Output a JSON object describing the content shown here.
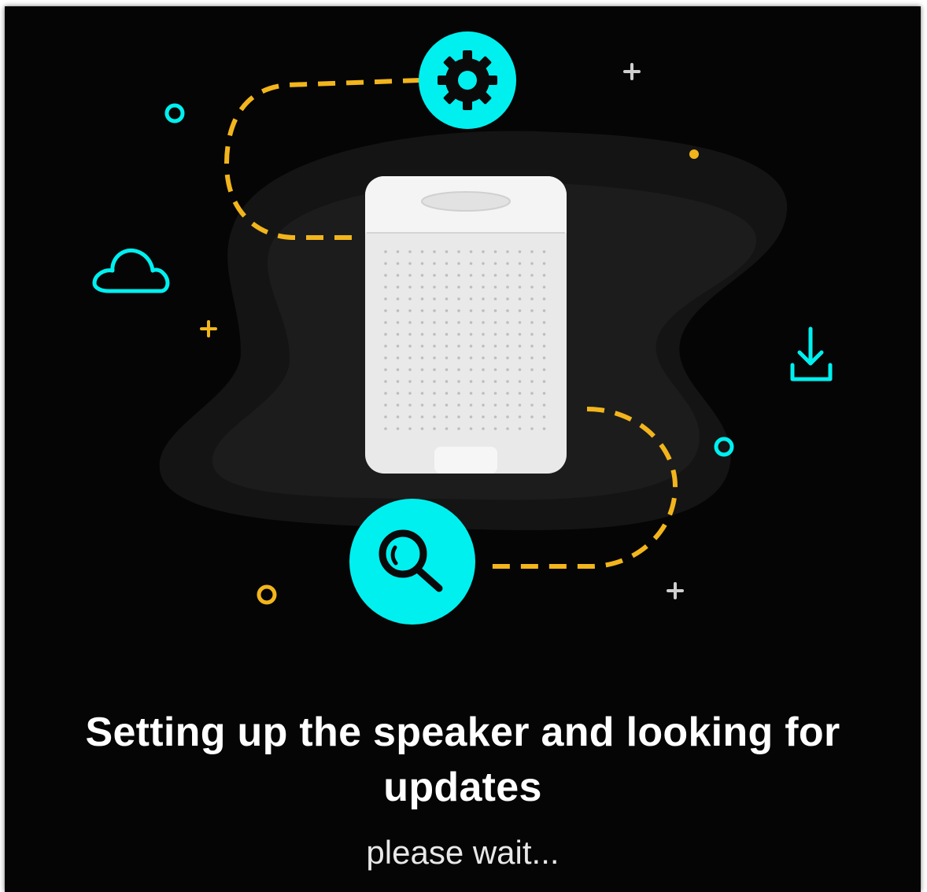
{
  "screen": {
    "title": "Setting up the speaker and looking for updates",
    "subtitle": "please wait..."
  },
  "illustration": {
    "icons": [
      "gear-icon",
      "magnifier-icon",
      "cloud-icon",
      "download-icon",
      "speaker"
    ],
    "colors": {
      "background": "#050505",
      "accent_cyan": "#00f0f0",
      "accent_yellow": "#f2b51c",
      "blob": "#1c1c1c",
      "speaker": "#e9e9e9"
    }
  }
}
